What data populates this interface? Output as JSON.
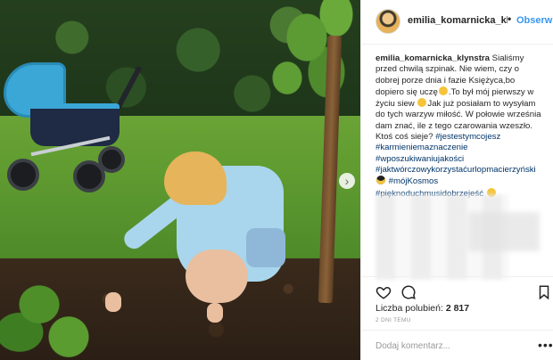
{
  "post": {
    "username": "emilia_komarnicka_klyn...",
    "follow_label": "Obserwuj",
    "caption_username": "emilia_komarnicka_klynstra",
    "caption_text_1": "Sialiśmy przed chwilą szpinak. Nie wiem, czy o dobrej porze dnia i fazie Księżyca,bo dopiero się uczę",
    "caption_text_2": ".To był mój pierwszy w życiu siew",
    "caption_text_3": "Jak już posiałam to wysyłam do tych warzyw miłość. W połowie września dam znać, ile z tego czarowania wzeszło. Ktoś coś sieje?",
    "caption_tag_inline": "#jestestymcojesz",
    "hashtags": [
      "#karmieniemaznaczenie",
      "#wposzukiwaniujakości",
      "#jaktwórczowykorzystaćurlopmacierzyński",
      "#mójKosmos",
      "#pięknoduchmusidobrzejeść"
    ],
    "likes_label": "Liczba polubień:",
    "likes_count": "2 817",
    "time_ago": "2 DNI TEMU",
    "comment_placeholder": "Dodaj komentarz...",
    "more_label": "•••"
  },
  "icons": [
    "heart-icon",
    "comment-icon",
    "bookmark-icon",
    "chevron-right-icon",
    "more-icon"
  ],
  "colors": {
    "link": "#3897f0",
    "hashtag": "#003569",
    "muted": "#999999",
    "text": "#262626"
  }
}
